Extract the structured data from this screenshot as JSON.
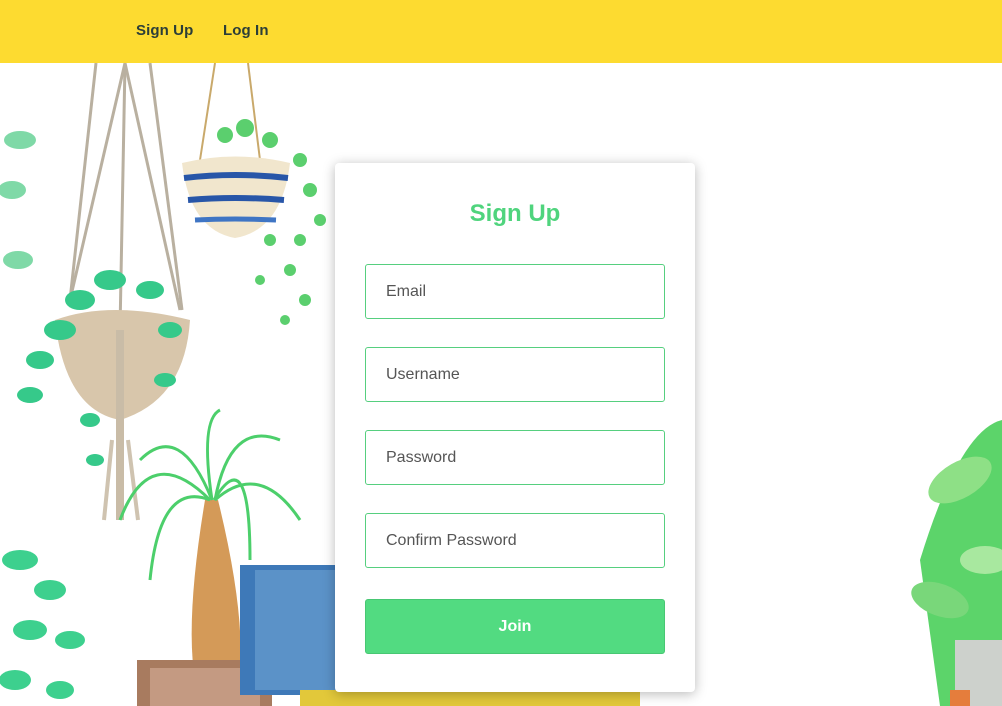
{
  "nav": {
    "signup_label": "Sign Up",
    "login_label": "Log In"
  },
  "form": {
    "title": "Sign Up",
    "email_placeholder": "Email",
    "username_placeholder": "Username",
    "password_placeholder": "Password",
    "confirm_placeholder": "Confirm Password",
    "join_label": "Join"
  },
  "colors": {
    "header": "#fddb30",
    "accent_green": "#4fd47d",
    "button_green": "#52db81"
  }
}
